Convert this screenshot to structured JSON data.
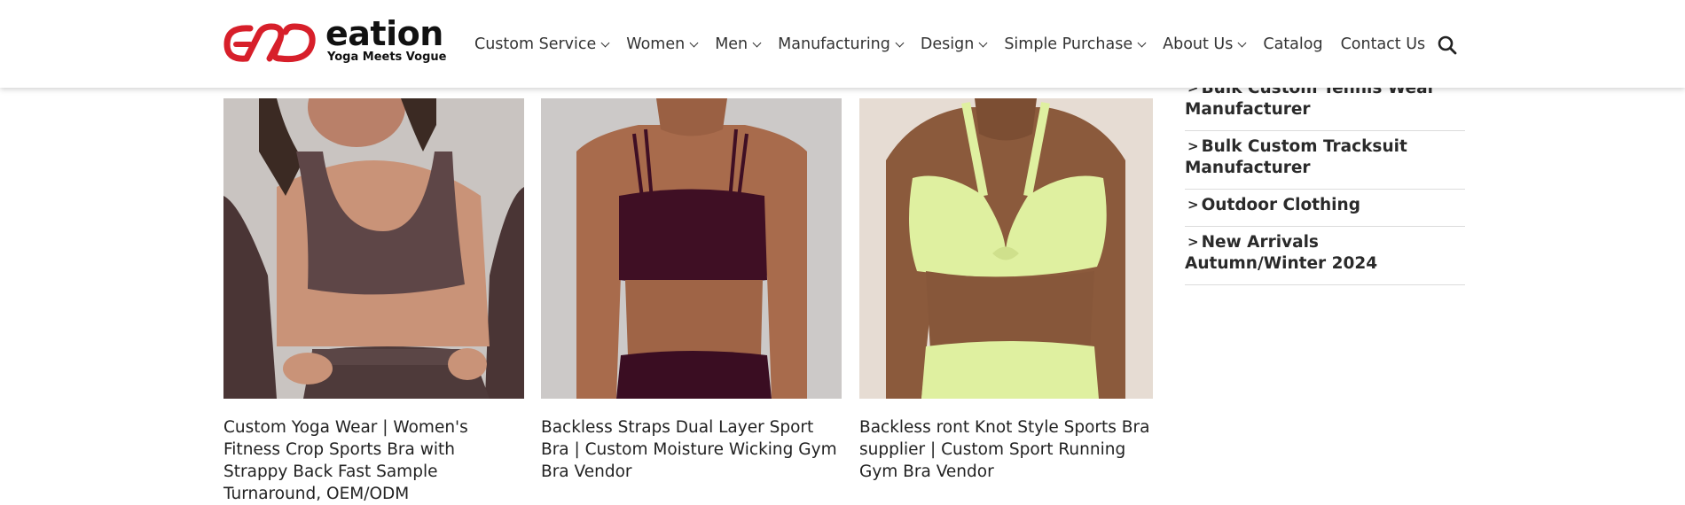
{
  "header": {
    "logo": {
      "word": "eation",
      "tagline": "Yoga Meets Vogue",
      "brand_color": "#d71f2a"
    },
    "nav": [
      {
        "label": "Custom Service",
        "has_dropdown": true
      },
      {
        "label": "Women",
        "has_dropdown": true
      },
      {
        "label": "Men",
        "has_dropdown": true
      },
      {
        "label": "Manufacturing",
        "has_dropdown": true
      },
      {
        "label": "Design",
        "has_dropdown": true
      },
      {
        "label": "Simple Purchase",
        "has_dropdown": true
      },
      {
        "label": "About Us",
        "has_dropdown": true
      },
      {
        "label": "Catalog",
        "has_dropdown": false
      },
      {
        "label": "Contact Us",
        "has_dropdown": false
      }
    ],
    "search_icon": "search-icon"
  },
  "products": [
    {
      "title": "Custom Yoga Wear | Women's Fitness Crop Sports Bra with Strappy Back Fast Sample Turnaround, OEM/ODM",
      "colors": {
        "bg": "#c9c4c1",
        "garment": "#5e4647",
        "skin": "#c99378"
      }
    },
    {
      "title": "Backless Straps Dual Layer Sport Bra | Custom Moisture Wicking Gym Bra Vendor",
      "colors": {
        "bg": "#ccc9c8",
        "garment": "#3f0f24",
        "skin": "#a86b4c"
      }
    },
    {
      "title": "Backless ront Knot Style Sports Bra supplier | Custom Sport Running Gym Bra Vendor",
      "colors": {
        "bg": "#e6dcd3",
        "garment": "#dff0a0",
        "skin": "#8b5a3c"
      }
    }
  ],
  "sidebar": {
    "items": [
      {
        "label": "Bulk Custom Tennis Wear Manufacturer"
      },
      {
        "label": "Bulk Custom Tracksuit Manufacturer"
      },
      {
        "label": "Outdoor Clothing"
      },
      {
        "label": "New Arrivals Autumn/Winter 2024"
      }
    ]
  }
}
